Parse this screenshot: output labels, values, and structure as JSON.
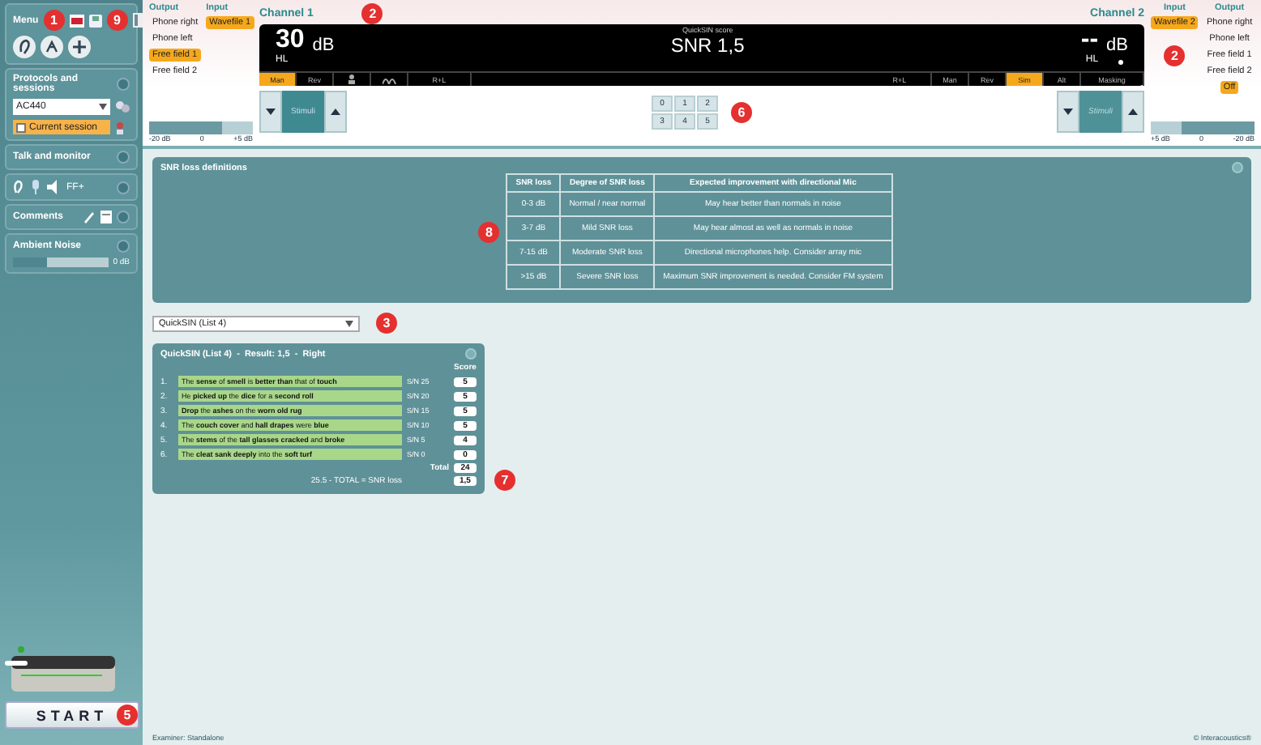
{
  "sidebar": {
    "menu": {
      "title": "Menu",
      "badge": "1",
      "tools_badge": "9"
    },
    "protocols": {
      "title": "Protocols and sessions",
      "protocol": "AC440",
      "session": "Current session"
    },
    "talk": {
      "title": "Talk and monitor"
    },
    "monitor": {
      "label": "FF+"
    },
    "comments": {
      "title": "Comments"
    },
    "ambient_noise": {
      "title": "Ambient Noise",
      "level": 0.35,
      "reading": "0 dB"
    },
    "start": {
      "label": "START",
      "badge": "5"
    }
  },
  "channel_1": {
    "title": "Channel 1",
    "output_heading": "Output",
    "input_heading": "Input",
    "outputs": [
      {
        "label": "Phone right",
        "selected": false
      },
      {
        "label": "Phone left",
        "selected": false
      },
      {
        "label": "Free field 1",
        "selected": true
      },
      {
        "label": "Free field 2",
        "selected": false
      }
    ],
    "inputs": [
      {
        "label": "Wavefile 1",
        "selected": true
      }
    ],
    "badge": "2",
    "intensity": "30",
    "unit": "dB",
    "scale": "HL",
    "modes": [
      {
        "kind": "text",
        "label": "Man",
        "selected": true
      },
      {
        "kind": "text",
        "label": "Rev",
        "selected": false
      },
      {
        "kind": "person",
        "selected": false
      },
      {
        "kind": "wave",
        "selected": false
      },
      {
        "kind": "text",
        "label": "R+L",
        "selected": false
      }
    ],
    "stimulus_label": "Stimuli",
    "stimulus_disabled": false,
    "level": 0.7,
    "ticks": [
      "-20 dB",
      "0",
      "+5 dB"
    ]
  },
  "score_display": {
    "caption": "QuickSIN score",
    "value": "SNR 1,5"
  },
  "channel_2": {
    "title": "Channel 2",
    "output_heading": "Output",
    "input_heading": "Input",
    "outputs": [
      {
        "label": "Phone right",
        "selected": false
      },
      {
        "label": "Phone left",
        "selected": false
      },
      {
        "label": "Free field 1",
        "selected": false
      },
      {
        "label": "Free field 2",
        "selected": false
      },
      {
        "label": "Off",
        "selected": true
      }
    ],
    "inputs": [
      {
        "label": "Wavefile 2",
        "selected": true
      }
    ],
    "badge": "2",
    "intensity": "--",
    "unit": "dB",
    "scale": "HL",
    "modes": [
      {
        "label": "R+L",
        "selected": false
      },
      {
        "label": "Man",
        "selected": false
      },
      {
        "label": "Rev",
        "selected": false
      },
      {
        "label": "Sim",
        "selected": true
      },
      {
        "label": "Alt",
        "selected": false
      },
      {
        "label": "Masking",
        "selected": false
      }
    ],
    "stimulus_label": "Stimuli",
    "stimulus_disabled": true,
    "level": 0.7,
    "ticks": [
      "+5 dB",
      "0",
      "-20 dB"
    ]
  },
  "list_pad": {
    "badge": "6",
    "keys": [
      "0",
      "1",
      "2",
      "3",
      "4",
      "5"
    ]
  },
  "snr_definitions": {
    "title": "SNR loss definitions",
    "badge": "8",
    "columns": [
      "SNR loss",
      "Degree of SNR loss",
      "Expected improvement with directional Mic"
    ],
    "rows": [
      [
        "0-3 dB",
        "Normal / near normal",
        "May hear better than normals in noise"
      ],
      [
        "3-7 dB",
        "Mild SNR loss",
        "May hear almost as well as normals in noise"
      ],
      [
        "7-15 dB",
        "Moderate SNR loss",
        "Directional microphones help. Consider array mic"
      ],
      [
        ">15 dB",
        "Severe SNR loss",
        "Maximum SNR improvement is needed. Consider FM system"
      ]
    ]
  },
  "list_select": {
    "value": "QuickSIN (List 4)",
    "badge": "3"
  },
  "quicksin": {
    "title": "QuickSIN (List 4)  -  Result: 1,5  -  Right",
    "score_heading": "Score",
    "badge": "7",
    "items": [
      {
        "number": "1.",
        "sentence": "The **sense** of **smell** is **better than** that of **touch**",
        "snr": "S/N 25",
        "score": "5"
      },
      {
        "number": "2.",
        "sentence": "He **picked up** the **dice** for a **second roll**",
        "snr": "S/N 20",
        "score": "5"
      },
      {
        "number": "3.",
        "sentence": "**Drop** the **ashes** on the **worn old rug**",
        "snr": "S/N 15",
        "score": "5"
      },
      {
        "number": "4.",
        "sentence": "The **couch cover** and **hall drapes** were **blue**",
        "snr": "S/N 10",
        "score": "5"
      },
      {
        "number": "5.",
        "sentence": "The **stems** of the **tall glasses cracked** and **broke**",
        "snr": "S/N 5",
        "score": "4"
      },
      {
        "number": "6.",
        "sentence": "The **cleat sank deeply** into the **soft turf**",
        "snr": "S/N 0",
        "score": "0"
      }
    ],
    "total_label": "Total",
    "total": "24",
    "formula": "25.5 - TOTAL = SNR loss",
    "result": "1,5"
  },
  "footer": {
    "examiner": "Examiner: Standalone",
    "copyright": "© Interacoustics®"
  }
}
